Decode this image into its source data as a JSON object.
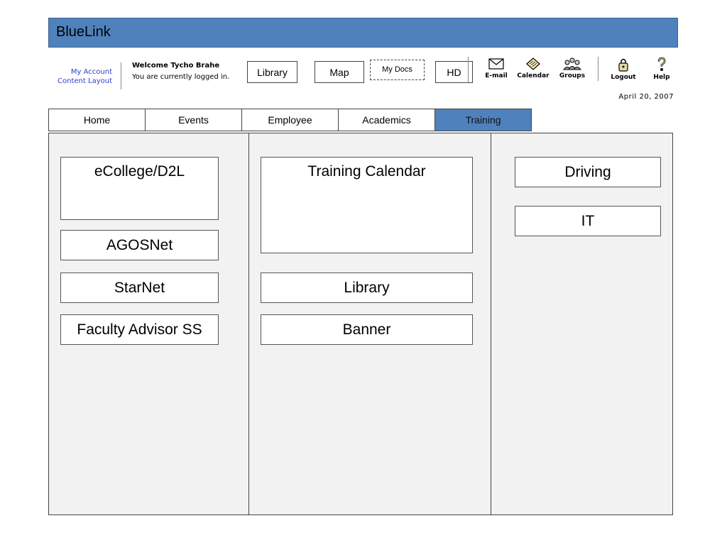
{
  "app": {
    "title": "BlueLink"
  },
  "account": {
    "my_account": "My Account",
    "content_layout": "Content Layout",
    "welcome": "Welcome Tycho Brahe",
    "status": "You are currently logged in."
  },
  "quick_links": [
    "Library",
    "Map",
    "My Docs",
    "HD"
  ],
  "tools": [
    {
      "label": "E-mail",
      "icon": "envelope-icon"
    },
    {
      "label": "Calendar",
      "icon": "calendar-icon"
    },
    {
      "label": "Groups",
      "icon": "groups-icon"
    },
    {
      "label": "Logout",
      "icon": "logout-icon"
    },
    {
      "label": "Help",
      "icon": "help-icon"
    }
  ],
  "date": "April 20, 2007",
  "tabs": [
    {
      "label": "Home"
    },
    {
      "label": "Events"
    },
    {
      "label": "Employee"
    },
    {
      "label": "Academics"
    },
    {
      "label": "Training",
      "active": true
    }
  ],
  "columns": {
    "left": [
      "eCollege/D2L",
      "AGOSNet",
      "StarNet",
      "Faculty Advisor SS"
    ],
    "middle": [
      "Training Calendar",
      "Library",
      "Banner"
    ],
    "right": [
      "Driving",
      "IT"
    ]
  },
  "colors": {
    "header": "#4f81bd",
    "panel": "#f2f2f2",
    "link": "#2b3fd0"
  }
}
